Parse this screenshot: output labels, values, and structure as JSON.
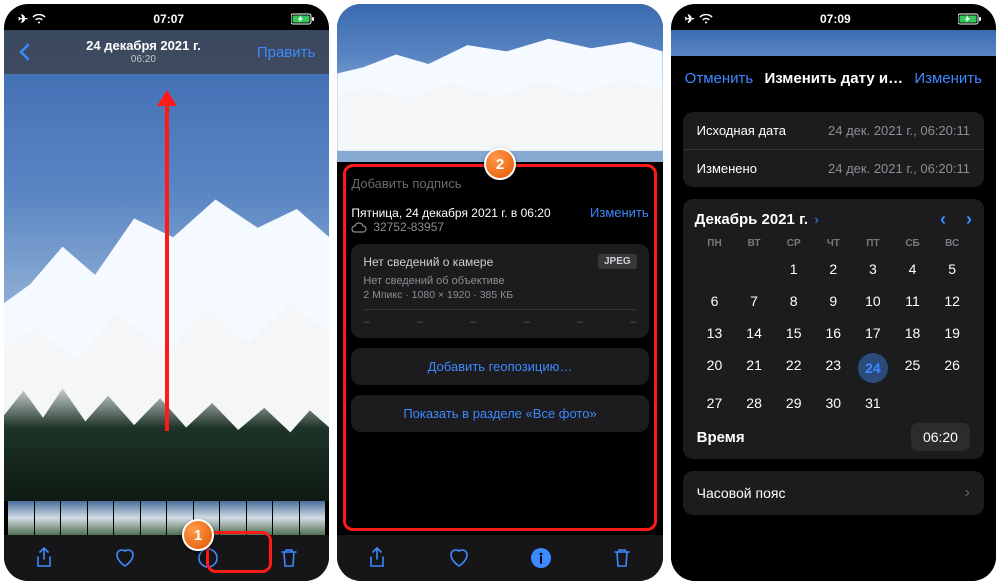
{
  "status": {
    "time1": "07:07",
    "time3": "07:09"
  },
  "s1": {
    "date": "24 декабря 2021 г.",
    "time": "06:20",
    "edit": "Править"
  },
  "s2": {
    "caption_ph": "Добавить подпись",
    "date_line": "Пятница, 24 декабря 2021 г. в 06:20",
    "adjust": "Изменить",
    "cloud_id": "32752-83957",
    "camera": "Нет сведений о камере",
    "format": "JPEG",
    "lens": "Нет сведений об объективе",
    "tech": "2 Мпикс · 1080 × 1920 · 385 КБ",
    "add_loc": "Добавить геопозицию…",
    "show_all": "Показать в разделе «Все фото»"
  },
  "s3": {
    "cancel": "Отменить",
    "title": "Изменить дату и…",
    "save": "Изменить",
    "orig_label": "Исходная дата",
    "orig_val": "24 дек. 2021 г., 06:20:11",
    "mod_label": "Изменено",
    "mod_val": "24 дек. 2021 г., 06:20:11",
    "month": "Декабрь 2021 г.",
    "dow": [
      "ПН",
      "ВТ",
      "СР",
      "ЧТ",
      "ПТ",
      "СБ",
      "ВС"
    ],
    "days": [
      null,
      null,
      1,
      2,
      3,
      4,
      5,
      6,
      7,
      8,
      9,
      10,
      11,
      12,
      13,
      14,
      15,
      16,
      17,
      18,
      19,
      20,
      21,
      22,
      23,
      24,
      25,
      26,
      27,
      28,
      29,
      30,
      31
    ],
    "selected": 24,
    "time_label": "Время",
    "time_val": "06:20",
    "tz": "Часовой пояс"
  }
}
